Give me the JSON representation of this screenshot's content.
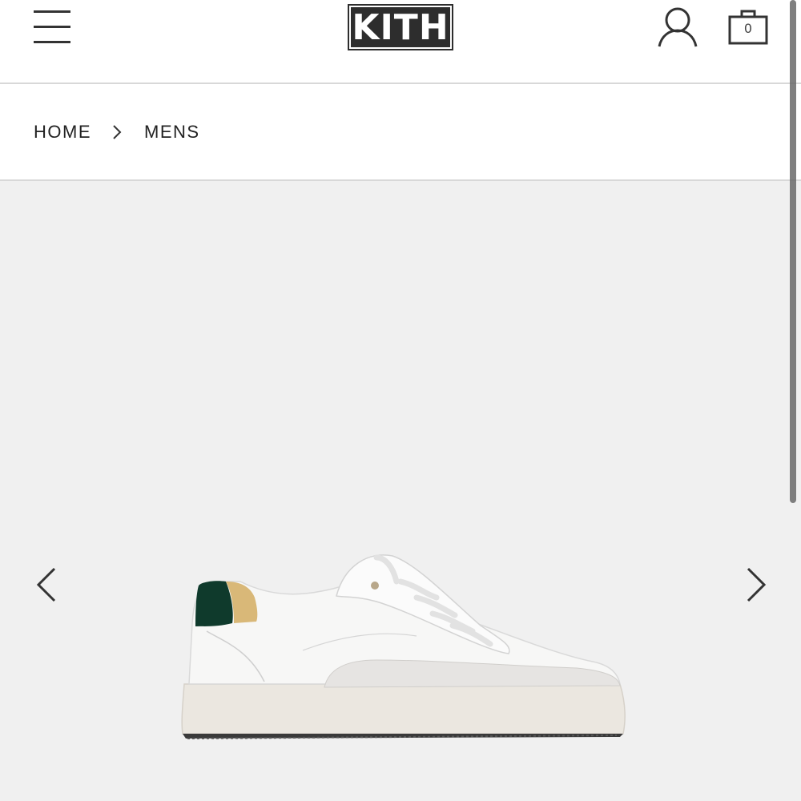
{
  "header": {
    "brand": "KITH",
    "cart_count": "0",
    "icons": [
      "hamburger-menu-icon",
      "user-account-icon",
      "shopping-bag-icon"
    ]
  },
  "breadcrumb": {
    "items": [
      {
        "label": "HOME"
      },
      {
        "label": "MENS"
      }
    ]
  },
  "gallery": {
    "image_subject": "white leather low-top sneaker",
    "prev_icon": "chevron-left-icon",
    "next_icon": "chevron-right-icon"
  },
  "colors": {
    "logo_bg": "#2d2d2d",
    "gallery_bg": "#f0f0f0",
    "accent_heel": "#0f3a2c"
  }
}
